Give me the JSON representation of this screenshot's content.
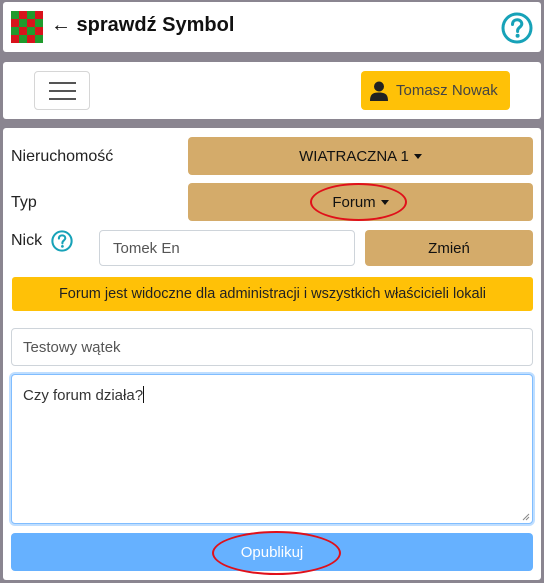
{
  "header": {
    "title": "← sprawdź Symbol",
    "logo_colors": [
      "#1f9a2c",
      "#d8121b"
    ],
    "help_icon": "question-circle-icon",
    "help_color": "#17a2b8"
  },
  "navbar": {
    "menu_icon": "hamburger-icon",
    "user_name": "Tomasz Nowak",
    "user_icon": "user-icon",
    "user_button_color": "#ffc107"
  },
  "form": {
    "property_label": "Nieruchomość",
    "property_value": "WIATRACZNA 1",
    "type_label": "Typ",
    "type_value": "Forum",
    "nick_label": "Nick",
    "nick_value": "Tomek En",
    "change_button": "Zmień",
    "notice": "Forum jest widoczne dla administracji i wszystkich właścicieli lokali",
    "thread_title_value": "Testowy wątek",
    "message_value": "Czy forum działa?",
    "publish_button": "Opublikuj",
    "dropdown_color": "#d4ab6a",
    "publish_color": "#66b1ff"
  }
}
